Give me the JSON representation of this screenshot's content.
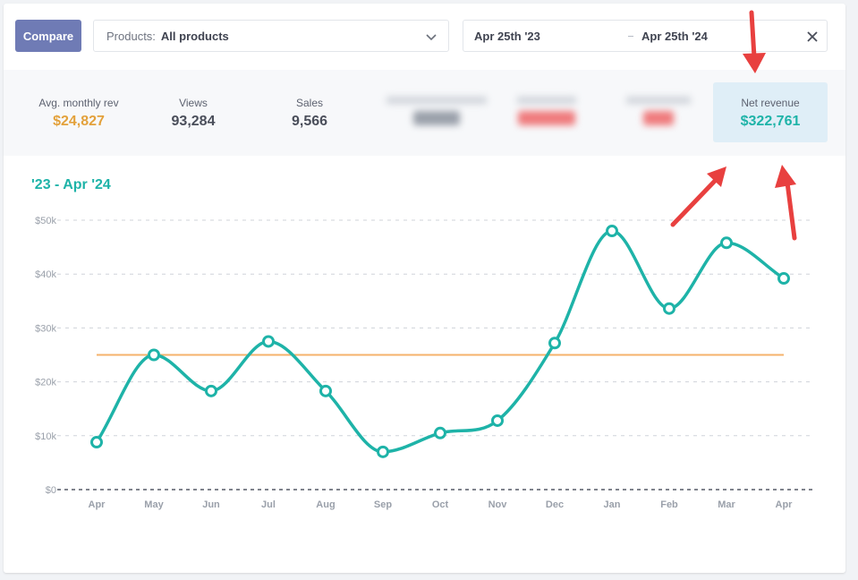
{
  "toolbar": {
    "compare_label": "Compare",
    "products_label": "Products:",
    "products_value": "All products",
    "date_start": "Apr 25th '23",
    "date_end": "Apr 25th '24"
  },
  "stats": [
    {
      "label": "Avg. monthly rev",
      "value": "$24,827",
      "color": "#e3a13b"
    },
    {
      "label": "Views",
      "value": "93,284"
    },
    {
      "label": "Sales",
      "value": "9,566"
    }
  ],
  "net_revenue": {
    "label": "Net revenue",
    "value": "$322,761",
    "color": "#1eb3a8"
  },
  "chart_data": {
    "type": "line",
    "title": "'23 - Apr '24",
    "categories": [
      "Apr",
      "May",
      "Jun",
      "Jul",
      "Aug",
      "Sep",
      "Oct",
      "Nov",
      "Dec",
      "Jan",
      "Feb",
      "Mar",
      "Apr"
    ],
    "series": [
      {
        "values": [
          8800,
          25000,
          18300,
          27500,
          18300,
          7000,
          10500,
          12800,
          27200,
          48000,
          33600,
          45800,
          39200
        ],
        "color": "#1eb3a8"
      }
    ],
    "reference_line": {
      "value": 25000,
      "color": "#f5b26b"
    },
    "y_ticks": [
      "$0",
      "$10k",
      "$20k",
      "$30k",
      "$40k",
      "$50k"
    ],
    "ylim": [
      0,
      50000
    ],
    "grid": true
  },
  "colors": {
    "accent": "#1eb3a8",
    "compare_button": "#6f7bb5",
    "annotation_arrows": "#e8403f"
  }
}
